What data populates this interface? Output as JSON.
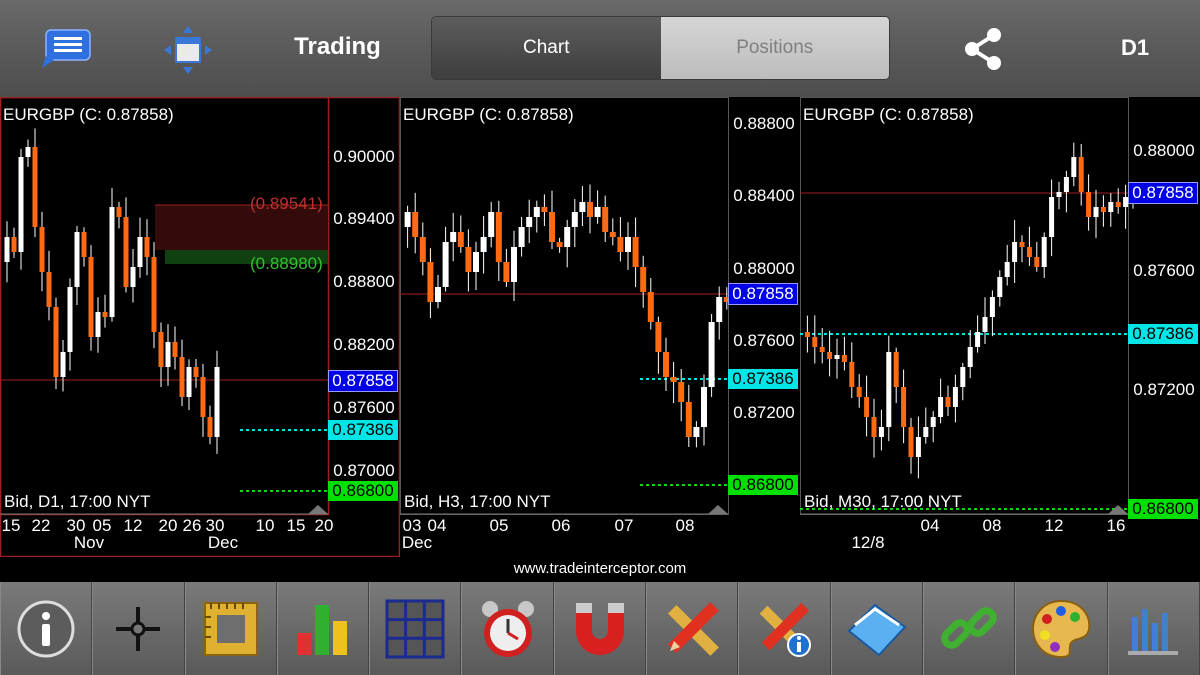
{
  "header": {
    "title": "Trading",
    "tabs": [
      "Chart",
      "Positions"
    ],
    "active_tab": "Chart",
    "timeframe": "D1",
    "icons": [
      "menu-icon",
      "move-arrows-icon",
      "share-icon"
    ]
  },
  "panels": [
    {
      "symbol": "EURGBP (C: 0.87858)",
      "bid_label": "Bid, D1, 17:00 NYT",
      "y_labels": [
        "0.90000",
        "0.89400",
        "0.88800",
        "0.88200",
        "0.87600",
        "0.87000"
      ],
      "price_boxes": {
        "current": "0.87858",
        "cyan": "0.87386",
        "green": "0.86800"
      },
      "levels": [
        "(0.89541)",
        "(0.88980)"
      ],
      "x_labels": [
        "15",
        "22",
        "30",
        "05",
        "12",
        "20",
        "26",
        "30",
        "10",
        "15",
        "20"
      ],
      "x_months": [
        "Nov",
        "Dec"
      ]
    },
    {
      "symbol": "EURGBP (C: 0.87858)",
      "bid_label": "Bid, H3, 17:00 NYT",
      "y_labels": [
        "0.88800",
        "0.88400",
        "0.88000",
        "0.87600",
        "0.87200"
      ],
      "price_boxes": {
        "current": "0.87858",
        "cyan": "0.87386",
        "green": "0.86800"
      },
      "x_labels": [
        "03",
        "04",
        "05",
        "06",
        "07",
        "08"
      ],
      "x_months": [
        "Dec"
      ]
    },
    {
      "symbol": "EURGBP (C: 0.87858)",
      "bid_label": "Bid, M30, 17:00 NYT",
      "y_labels": [
        "0.88000",
        "0.87600",
        "0.87200"
      ],
      "price_boxes": {
        "current": "0.87858",
        "cyan": "0.87386",
        "green": "0.86800"
      },
      "x_labels": [
        "04",
        "08",
        "12",
        "16"
      ],
      "x_months": [
        "12/8"
      ]
    }
  ],
  "url": "www.tradeinterceptor.com",
  "toolbar": [
    "info-icon",
    "crosshair-icon",
    "ruler-frame-icon",
    "indicators-bar-icon",
    "grid-icon",
    "alarm-clock-icon",
    "magnet-icon",
    "draw-tools-icon",
    "draw-info-icon",
    "templates-icon",
    "link-icon",
    "palette-icon",
    "chart-settings-icon"
  ],
  "colors": {
    "bull": "#ffffff",
    "bear": "#ff6a13",
    "blue_box": "#0000e6",
    "cyan": "#00e5e5",
    "green": "#00e000",
    "red_line": "#a02020"
  }
}
